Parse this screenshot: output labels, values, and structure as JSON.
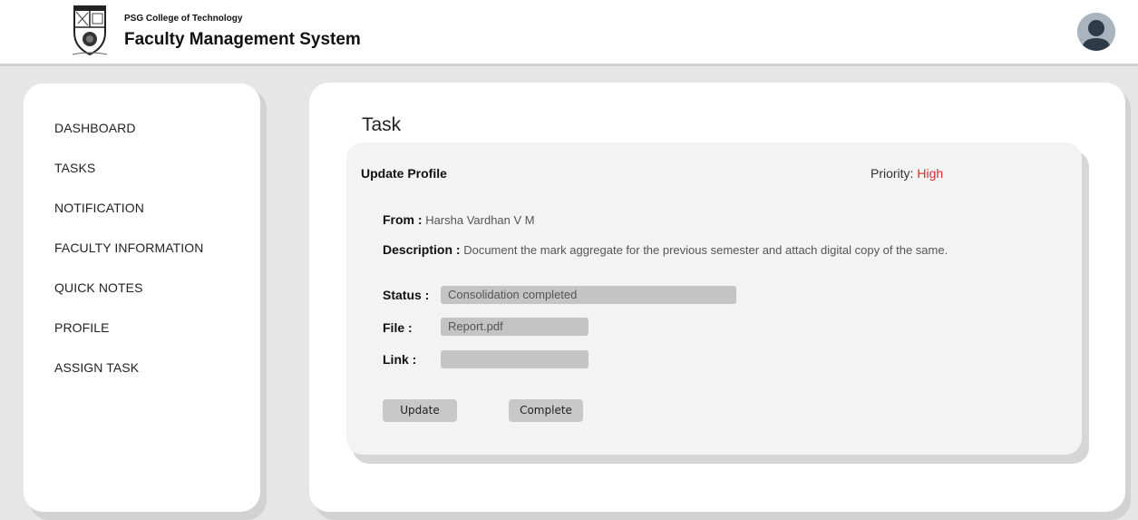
{
  "header": {
    "college": "PSG College of Technology",
    "system": "Faculty Management System",
    "logo_icon": "college-crest-icon",
    "avatar_icon": "user-avatar-icon"
  },
  "sidebar": {
    "items": [
      {
        "label": "DASHBOARD"
      },
      {
        "label": "TASKS"
      },
      {
        "label": "NOTIFICATION"
      },
      {
        "label": "FACULTY INFORMATION"
      },
      {
        "label": "QUICK NOTES"
      },
      {
        "label": "PROFILE"
      },
      {
        "label": "ASSIGN TASK"
      }
    ]
  },
  "main": {
    "title": "Task",
    "task": {
      "name": "Update Profile",
      "priority_label": "Priority:",
      "priority_value": "High",
      "from_label": "From :",
      "from_value": "Harsha Vardhan V M",
      "description_label": "Description :",
      "description_value": "Document the mark aggregate for the previous semester and attach digital copy of the same.",
      "status_label": "Status :",
      "status_value": "Consolidation completed",
      "file_label": "File :",
      "file_value": "Report.pdf",
      "link_label": "Link :",
      "link_value": ""
    },
    "buttons": {
      "update": "Update",
      "complete": "Complete"
    }
  },
  "colors": {
    "priority_high": "#d92b2b",
    "background": "#e6e6e6",
    "field": "#c4c4c4"
  }
}
